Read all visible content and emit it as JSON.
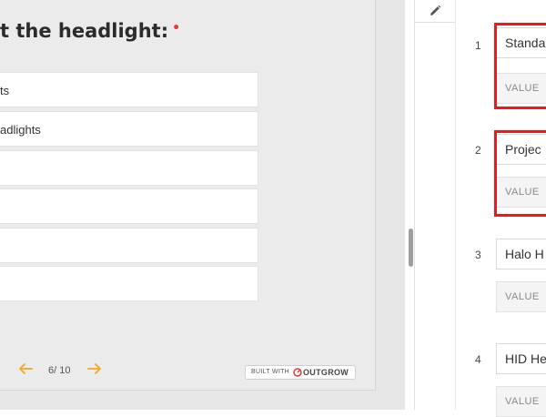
{
  "preview": {
    "question_title": "t the headlight:",
    "required_mark": "•",
    "options": [
      {
        "label": "ts"
      },
      {
        "label": "adlights"
      },
      {
        "label": ""
      },
      {
        "label": ""
      },
      {
        "label": ""
      },
      {
        "label": ""
      }
    ],
    "page_indicator": "6/ 10",
    "built_with_label": "BUILT WITH",
    "brand_name": "OUTGROW"
  },
  "editor": {
    "options": [
      {
        "number": "1",
        "label": "Standa",
        "value_placeholder": "VALUE",
        "highlighted": true
      },
      {
        "number": "2",
        "label": "Projec",
        "value_placeholder": "VALUE",
        "highlighted": true
      },
      {
        "number": "3",
        "label": "Halo H",
        "value_placeholder": "VALUE",
        "highlighted": false
      },
      {
        "number": "4",
        "label": "HID He",
        "value_placeholder": "VALUE",
        "highlighted": false
      }
    ]
  },
  "colors": {
    "accent_arrow": "#f5a623",
    "highlight_border": "#e01e1e",
    "required_mark": "#e53935"
  },
  "icons": [
    "pencil-icon",
    "prev-arrow-icon",
    "next-arrow-icon",
    "outgrow-logo-icon"
  ]
}
